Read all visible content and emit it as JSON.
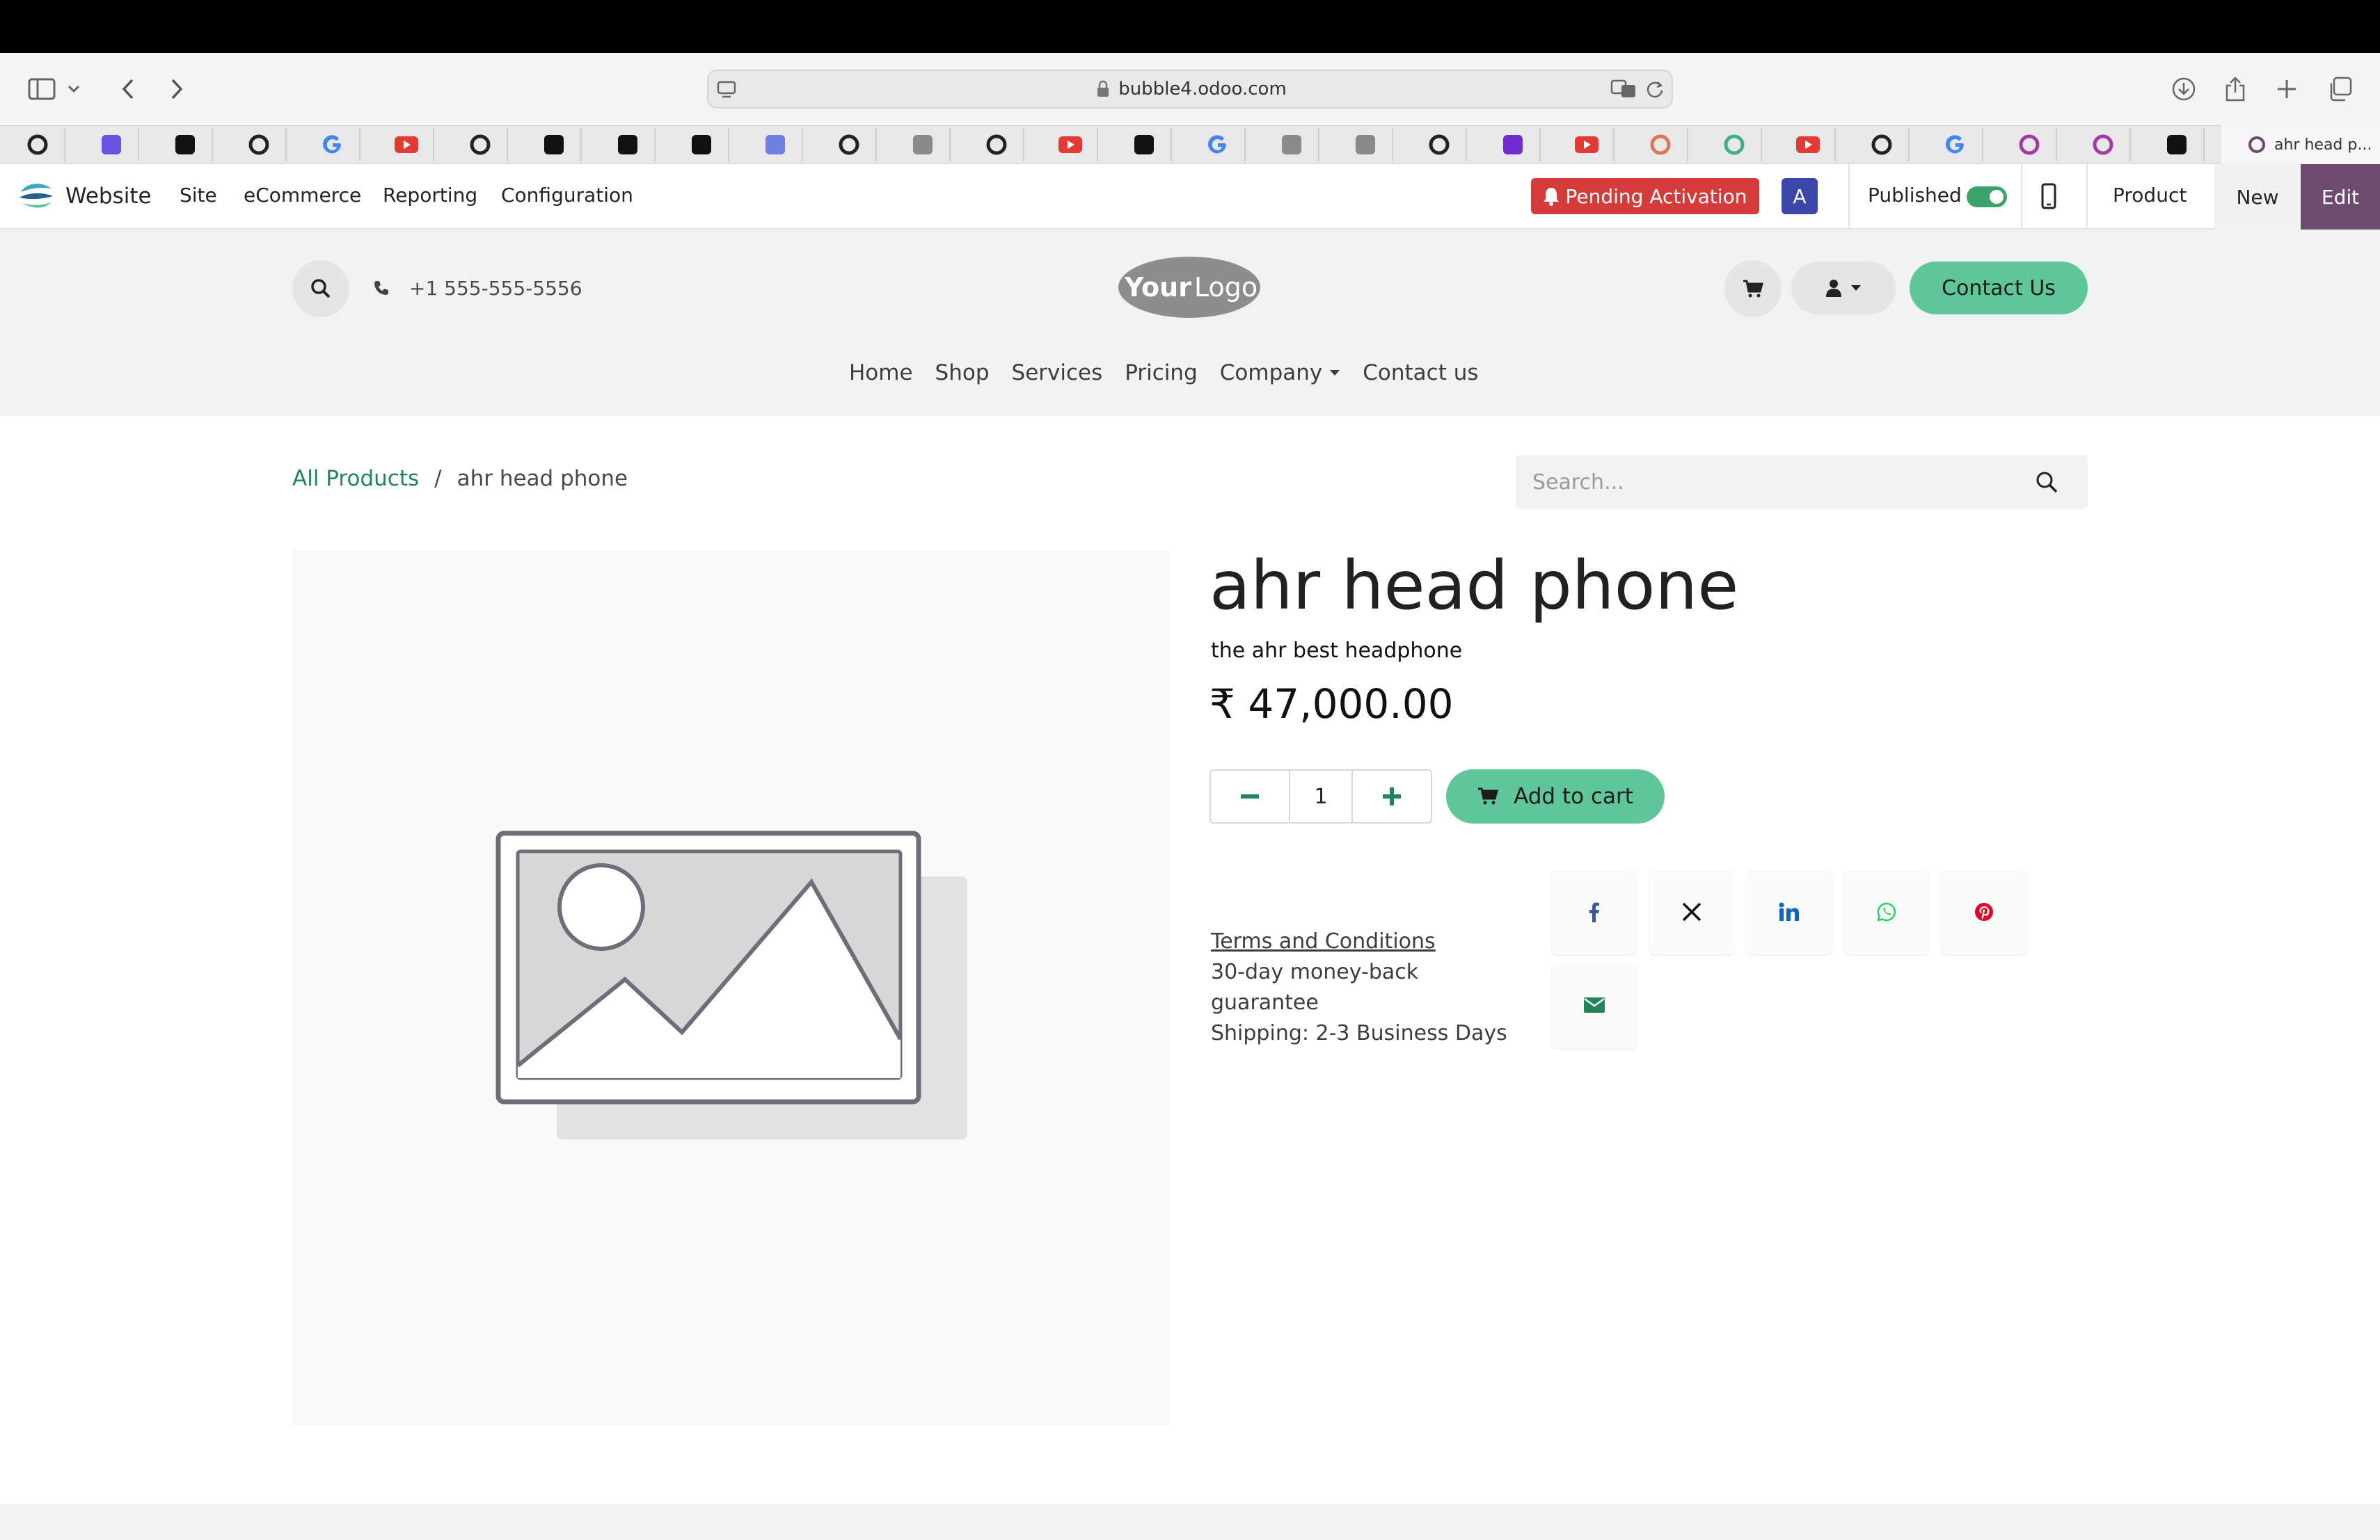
{
  "browser": {
    "url": "bubble4.odoo.com",
    "active_tab_title": "ahr head p..."
  },
  "admin_bar": {
    "app_name": "Website",
    "menu": [
      "Site",
      "eCommerce",
      "Reporting",
      "Configuration"
    ],
    "pending_label": "Pending Activation",
    "avatar_letter": "A",
    "published_label": "Published",
    "published": true,
    "product_label": "Product",
    "new_label": "New",
    "edit_label": "Edit"
  },
  "header": {
    "phone": "+1 555-555-5556",
    "logo_text_bold": "Your",
    "logo_text_light": "Logo",
    "contact_button": "Contact Us",
    "nav": [
      "Home",
      "Shop",
      "Services",
      "Pricing",
      "Company",
      "Contact us"
    ]
  },
  "breadcrumb": {
    "parent": "All Products",
    "separator": "/",
    "current": "ahr head phone"
  },
  "search": {
    "placeholder": "Search..."
  },
  "product": {
    "name": "ahr head phone",
    "description": "the ahr best headphone",
    "price": "₹ 47,000.00",
    "quantity": "1",
    "add_to_cart": "Add to cart",
    "terms_link": "Terms and Conditions",
    "guarantee": "30-day money-back guarantee",
    "shipping": "Shipping: 2-3 Business Days"
  },
  "share": {
    "icons": [
      "facebook-icon",
      "x-icon",
      "linkedin-icon",
      "whatsapp-icon",
      "pinterest-icon",
      "email-icon"
    ]
  },
  "colors": {
    "brand_green": "#5fc59a",
    "link_green": "#23845a",
    "pending_red": "#d63b3b",
    "edit_purple": "#6f4a6f",
    "avatar_blue": "#3a47a8"
  }
}
